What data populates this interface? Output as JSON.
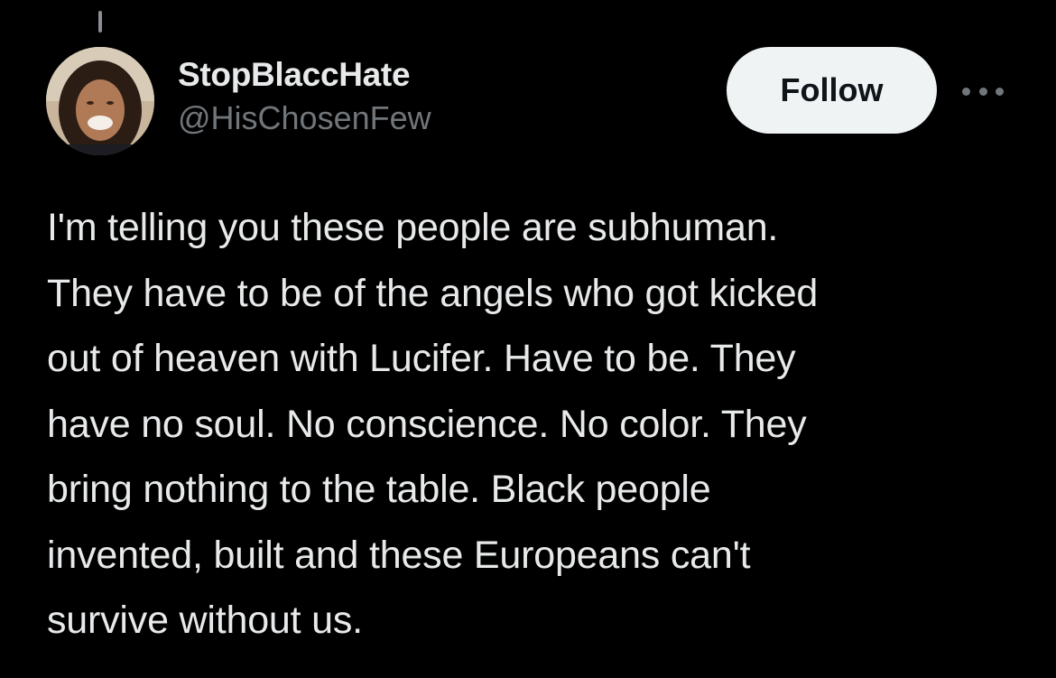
{
  "tweet": {
    "author": {
      "display_name": "StopBlaccHate",
      "handle": "@HisChosenFew",
      "avatar_icon": "profile-photo"
    },
    "follow_label": "Follow",
    "more_icon": "more-horizontal-icon",
    "text": "I'm telling you these people are subhuman.\nThey have to be of the angels who got kicked\nout of heaven with Lucifer. Have to be. They\nhave no soul. No conscience. No color. They\nbring nothing to the table. Black people\ninvented, built and these Europeans can't\nsurvive without us."
  },
  "colors": {
    "background": "#000000",
    "primary_text": "#e7e9ea",
    "secondary_text": "#71767b",
    "button_bg": "#eff3f4",
    "button_text": "#0f1419"
  }
}
